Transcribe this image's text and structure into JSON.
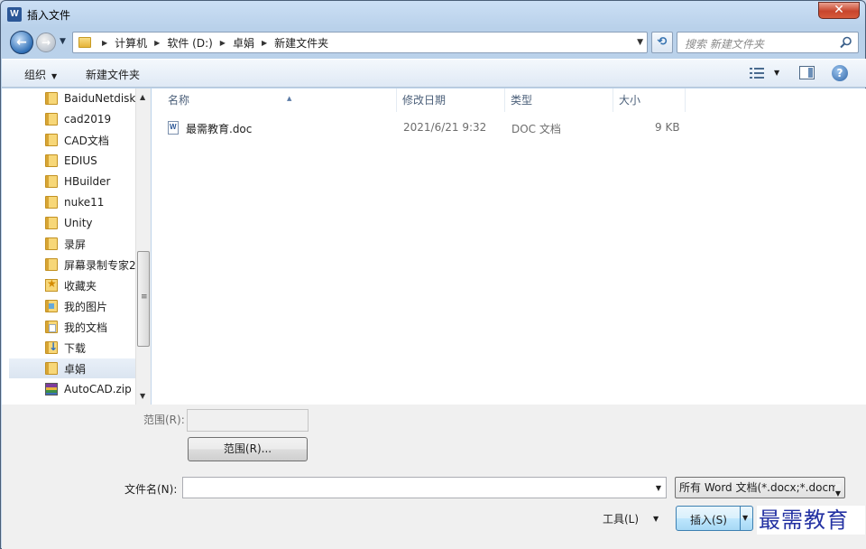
{
  "window": {
    "title": "插入文件",
    "app_icon": "word-icon",
    "close_glyph": "✕"
  },
  "nav": {
    "back_glyph": "←",
    "forward_glyph": "→",
    "breadcrumbs": [
      "计算机",
      "软件 (D:)",
      "卓娟",
      "新建文件夹"
    ],
    "search_placeholder": "搜索 新建文件夹"
  },
  "toolbar": {
    "organize_label": "组织",
    "new_folder_label": "新建文件夹",
    "help_glyph": "?"
  },
  "navpane": {
    "items": [
      {
        "label": "BaiduNetdisk",
        "icon": "folder-icon"
      },
      {
        "label": "cad2019",
        "icon": "folder-icon"
      },
      {
        "label": "CAD文档",
        "icon": "folder-icon"
      },
      {
        "label": "EDIUS",
        "icon": "folder-icon"
      },
      {
        "label": "HBuilder",
        "icon": "folder-icon"
      },
      {
        "label": "nuke11",
        "icon": "folder-icon"
      },
      {
        "label": "Unity",
        "icon": "folder-icon"
      },
      {
        "label": "录屏",
        "icon": "folder-icon"
      },
      {
        "label": "屏幕录制专家2",
        "icon": "folder-icon"
      },
      {
        "label": "收藏夹",
        "icon": "favorites-icon"
      },
      {
        "label": "我的图片",
        "icon": "pictures-folder-icon"
      },
      {
        "label": "我的文档",
        "icon": "documents-folder-icon"
      },
      {
        "label": "下载",
        "icon": "downloads-folder-icon"
      },
      {
        "label": "卓娟",
        "icon": "folder-icon",
        "selected": true
      },
      {
        "label": "AutoCAD.zip",
        "icon": "zip-archive-icon"
      }
    ]
  },
  "filelist": {
    "columns": [
      "名称",
      "修改日期",
      "类型",
      "大小"
    ],
    "files": [
      {
        "name": "最需教育.doc",
        "modified": "2021/6/21 9:32",
        "type": "DOC 文档",
        "size": "9 KB"
      }
    ]
  },
  "bottom": {
    "range_label": "范围(R):",
    "range_button_label": "范围(R)...",
    "filename_label": "文件名(N):",
    "filename_value": "",
    "filetype_value": "所有 Word 文档(*.docx;*.docm",
    "tools_label": "工具(L)",
    "insert_label": "插入(S)",
    "watermark": "最需教育"
  },
  "colors": {
    "accent": "#2f6fb6",
    "selected_row": "#dbe5f1",
    "watermark": "#2432a3"
  }
}
